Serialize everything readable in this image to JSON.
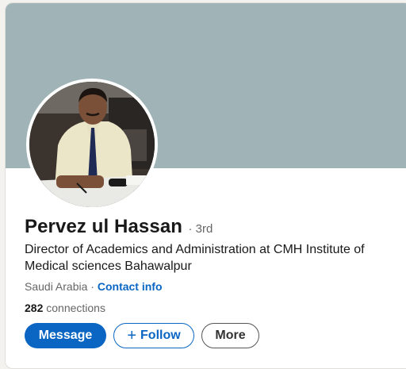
{
  "profile": {
    "name": "Pervez ul Hassan",
    "degree": "· 3rd",
    "headline": "Director of Academics and Administration at CMH Institute of Medical sciences Bahawalpur",
    "location": "Saudi Arabia",
    "separator": " · ",
    "contact_info_label": "Contact info",
    "connections_count": "282",
    "connections_label": " connections"
  },
  "actions": {
    "message_label": "Message",
    "follow_label": "Follow",
    "follow_icon": "plus-icon",
    "more_label": "More"
  },
  "colors": {
    "banner": "#a0b4b7",
    "accent": "#0a66c2",
    "text_primary": "#191919",
    "text_secondary": "#666666"
  }
}
